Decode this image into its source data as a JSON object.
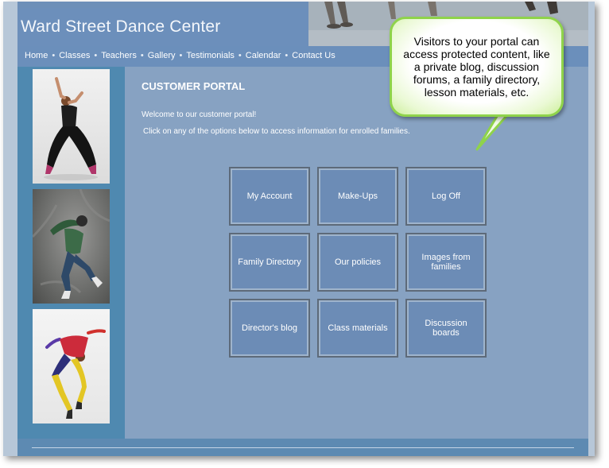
{
  "site": {
    "title": "Ward Street Dance Center",
    "nav": [
      "Home",
      "Classes",
      "Teachers",
      "Gallery",
      "Testimonials",
      "Calendar",
      "Contact Us"
    ],
    "nav_separator": "•"
  },
  "portal": {
    "heading": "CUSTOMER PORTAL",
    "welcome": "Welcome to our customer portal!",
    "instruction": "Click on any of the options below to access information for enrolled families.",
    "tiles": [
      {
        "label": "My Account"
      },
      {
        "label": "Make-Ups"
      },
      {
        "label": "Log Off"
      },
      {
        "label": "Family Directory"
      },
      {
        "label": "Our policies"
      },
      {
        "label": "Images from families"
      },
      {
        "label": "Director's blog"
      },
      {
        "label": "Class materials"
      },
      {
        "label": "Discussion boards"
      }
    ]
  },
  "callout": {
    "text": "Visitors to your portal can access protected content, like a private blog, discussion forums, a family directory, lesson materials, etc."
  },
  "colors": {
    "content_bg": "#87a2c2",
    "sidebar_bg": "#4f89b0",
    "tile_bg": "#6c8cb6",
    "callout_border": "#8fd34b"
  }
}
